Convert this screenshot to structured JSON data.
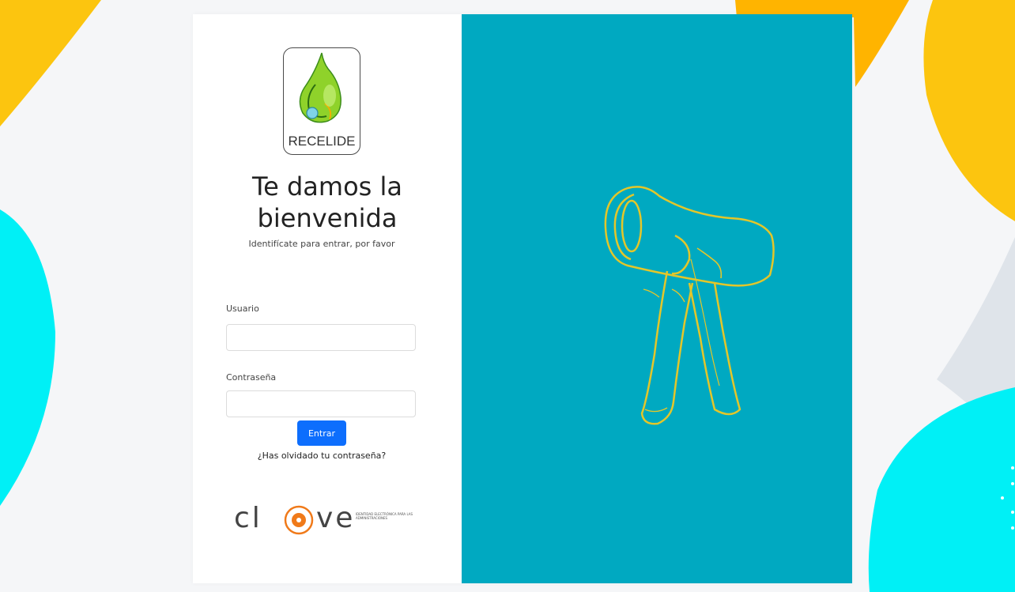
{
  "colors": {
    "page_bg": "#f5f6f8",
    "yellow_shape": "#fcc50f",
    "orange_shape": "#ffb400",
    "cyan_shape": "#00f0f6",
    "gray_shape": "#dfe4ea",
    "right_panel_bg": "#00a9c1",
    "key_line": "#e3c62a",
    "button_bg": "#0d6efd",
    "clave_accent": "#f07a1a"
  },
  "logo": {
    "text": "RECELIDE",
    "icon": "water-drop-logo-icon"
  },
  "welcome": {
    "title_line1": "Te damos la",
    "title_line2": "bienvenida",
    "subtitle": "Identifícate para entrar, por favor"
  },
  "form": {
    "username_label": "Usuario",
    "username_value": "",
    "password_label": "Contraseña",
    "password_value": "",
    "submit_label": "Entrar",
    "forgot_label": "¿Has olvidado tu contraseña?"
  },
  "clave": {
    "text_left": "cl",
    "text_right": "ve",
    "icon": "clave-at-icon",
    "tagline": "Identidad electrónica para las administraciones"
  },
  "illustration": {
    "icon": "key-outline-icon"
  }
}
